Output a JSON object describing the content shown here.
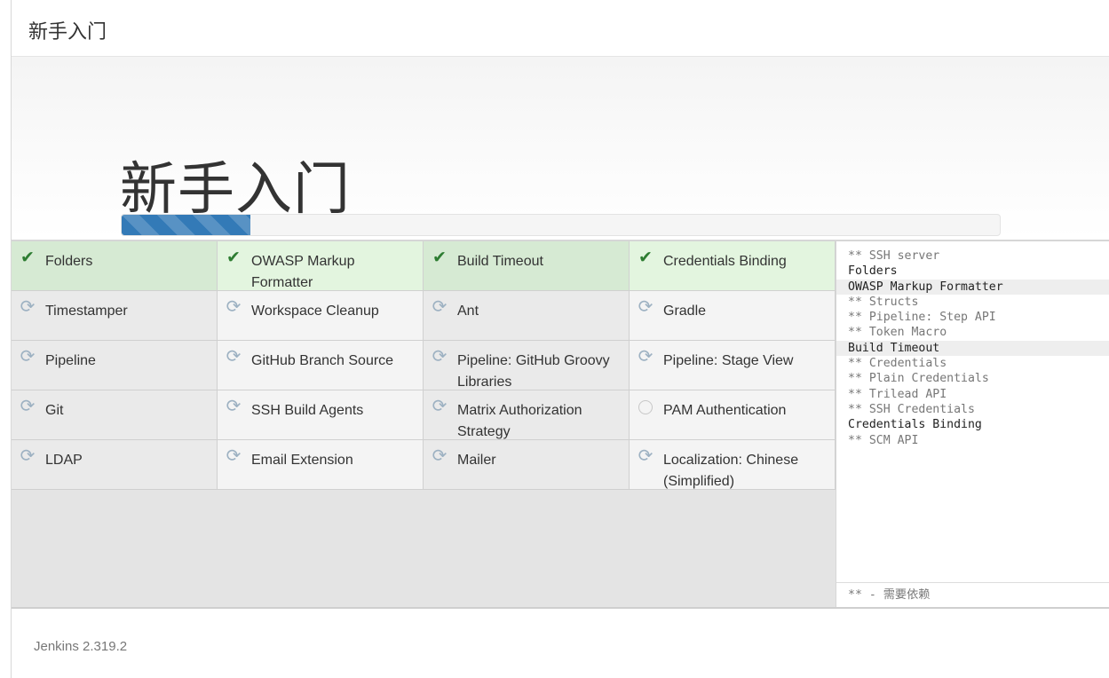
{
  "header": {
    "title": "新手入门"
  },
  "hero": {
    "title": "新手入门",
    "progress_percent": 14.7
  },
  "plugins": [
    {
      "name": "Folders",
      "status": "done"
    },
    {
      "name": "OWASP Markup Formatter",
      "status": "done"
    },
    {
      "name": "Build Timeout",
      "status": "done"
    },
    {
      "name": "Credentials Binding",
      "status": "done"
    },
    {
      "name": "Timestamper",
      "status": "installing"
    },
    {
      "name": "Workspace Cleanup",
      "status": "installing"
    },
    {
      "name": "Ant",
      "status": "installing"
    },
    {
      "name": "Gradle",
      "status": "installing"
    },
    {
      "name": "Pipeline",
      "status": "installing"
    },
    {
      "name": "GitHub Branch Source",
      "status": "installing"
    },
    {
      "name": "Pipeline: GitHub Groovy Libraries",
      "status": "installing"
    },
    {
      "name": "Pipeline: Stage View",
      "status": "installing"
    },
    {
      "name": "Git",
      "status": "installing"
    },
    {
      "name": "SSH Build Agents",
      "status": "installing"
    },
    {
      "name": "Matrix Authorization Strategy",
      "status": "installing"
    },
    {
      "name": "PAM Authentication",
      "status": "pending"
    },
    {
      "name": "LDAP",
      "status": "installing"
    },
    {
      "name": "Email Extension",
      "status": "installing"
    },
    {
      "name": "Mailer",
      "status": "installing"
    },
    {
      "name": "Localization: Chinese (Simplified)",
      "status": "installing"
    }
  ],
  "log": {
    "lines": [
      {
        "text": "** SSH server",
        "done": false,
        "highlight": false
      },
      {
        "text": "Folders",
        "done": true,
        "highlight": false
      },
      {
        "text": "OWASP Markup Formatter",
        "done": true,
        "highlight": true
      },
      {
        "text": "** Structs",
        "done": false,
        "highlight": false
      },
      {
        "text": "** Pipeline: Step API",
        "done": false,
        "highlight": false
      },
      {
        "text": "** Token Macro",
        "done": false,
        "highlight": false
      },
      {
        "text": "Build Timeout",
        "done": true,
        "highlight": true
      },
      {
        "text": "** Credentials",
        "done": false,
        "highlight": false
      },
      {
        "text": "** Plain Credentials",
        "done": false,
        "highlight": false
      },
      {
        "text": "** Trilead API",
        "done": false,
        "highlight": false
      },
      {
        "text": "** SSH Credentials",
        "done": false,
        "highlight": false
      },
      {
        "text": "Credentials Binding",
        "done": true,
        "highlight": false
      },
      {
        "text": "** SCM API",
        "done": false,
        "highlight": false
      }
    ],
    "legend": "** - 需要依赖"
  },
  "footer": {
    "version": "Jenkins 2.319.2"
  },
  "colors": {
    "accent": "#337ab7",
    "success": "#2e7d32",
    "done_bg": "#e3f5df"
  }
}
